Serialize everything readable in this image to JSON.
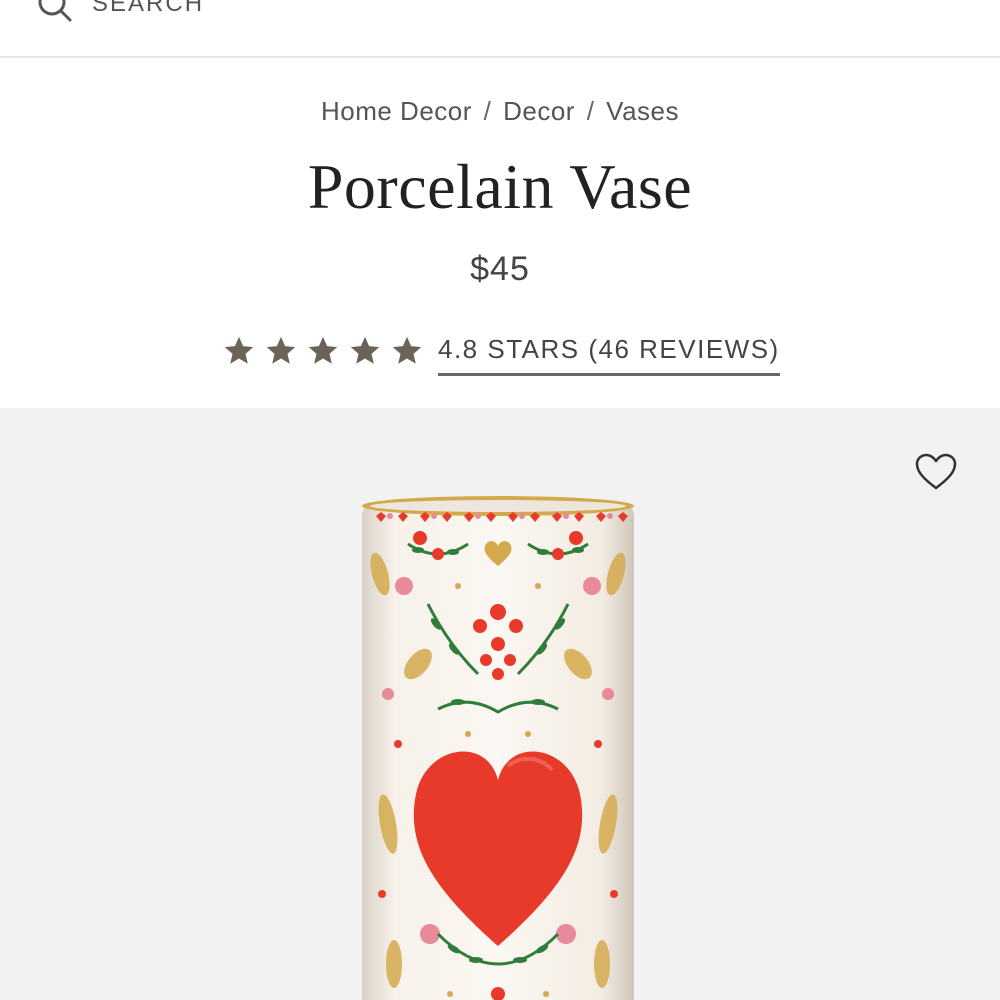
{
  "search": {
    "label": "SEARCH"
  },
  "breadcrumb": {
    "items": [
      "Home Decor",
      "Decor",
      "Vases"
    ],
    "separator": "/"
  },
  "product": {
    "title": "Porcelain Vase",
    "price": "$45",
    "rating": {
      "stars_filled": 5,
      "stars_total": 5,
      "link_text": "4.8 STARS (46 REVIEWS)"
    }
  },
  "image": {
    "alt": "Porcelain Vase"
  },
  "icons": {
    "search": "search-icon",
    "star": "star-icon",
    "favorite": "heart-outline-icon"
  },
  "colors": {
    "star": "#6b6357",
    "image_bg": "#f2f2f2",
    "vase_heart": "#e83a2a",
    "vase_gold": "#d4a94c",
    "vase_green": "#2f7d3a",
    "vase_pink": "#e98a9a"
  }
}
